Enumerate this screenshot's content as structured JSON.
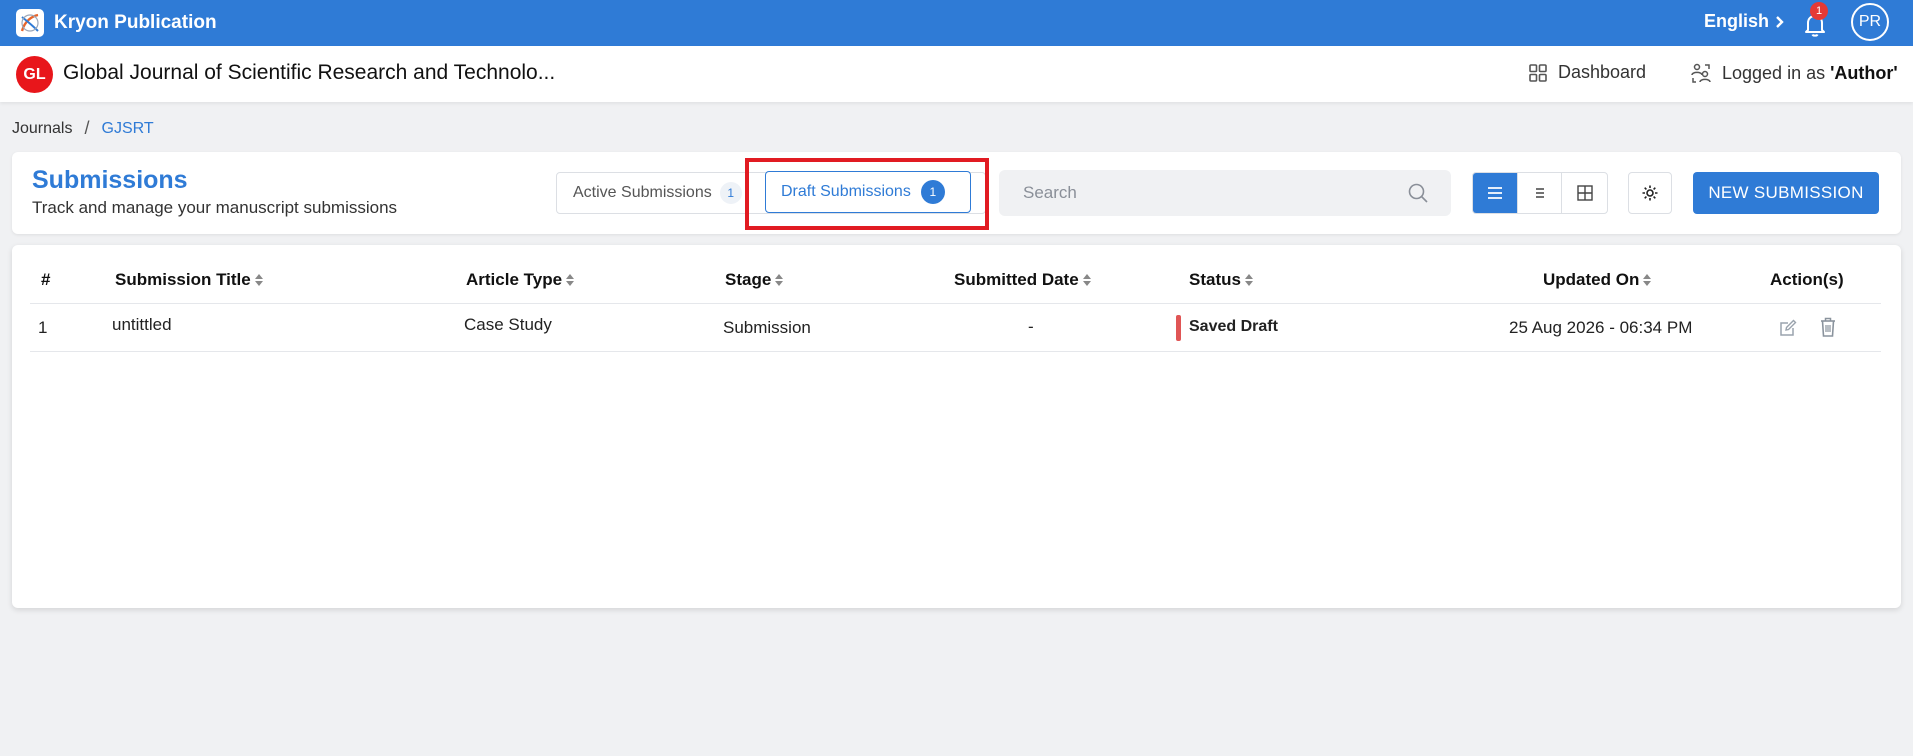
{
  "topbar": {
    "app_name": "Kryon Publication",
    "language": "English",
    "notification_count": "1",
    "user_initials": "PR"
  },
  "journal": {
    "logo_initials": "GL",
    "title": "Global Journal of Scientific Research and Technolo...",
    "dashboard_label": "Dashboard",
    "logged_in_prefix": "Logged in as ",
    "logged_in_role": "'Author'"
  },
  "breadcrumb": {
    "root": "Journals",
    "separator": "/",
    "current": "GJSRT"
  },
  "submissions": {
    "title": "Submissions",
    "description": "Track and manage your manuscript submissions",
    "tabs": [
      {
        "label": "Active Submissions",
        "count": "1"
      },
      {
        "label": "Draft Submissions",
        "count": "1"
      }
    ],
    "search_placeholder": "Search",
    "new_button": "NEW SUBMISSION"
  },
  "table": {
    "headers": [
      "#",
      "Submission Title",
      "Article Type",
      "Stage",
      "Submitted Date",
      "Status",
      "Updated On",
      "Action(s)"
    ],
    "rows": [
      {
        "num": "1",
        "title": "untittled",
        "article_type": "Case Study",
        "stage": "Submission",
        "submitted_date": "-",
        "status": "Saved Draft",
        "updated_on": "25 Aug 2026 - 06:34 PM"
      }
    ]
  },
  "colors": {
    "primary": "#2f7bd6",
    "highlight": "#e11b22",
    "status_draft": "#e05555",
    "journal_logo": "#e8161b"
  }
}
